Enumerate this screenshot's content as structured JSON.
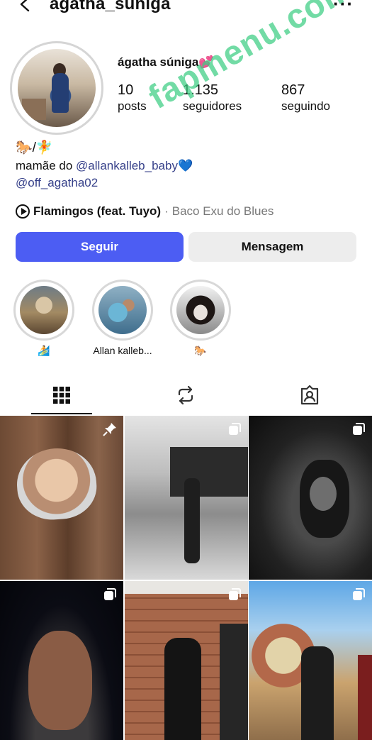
{
  "header": {
    "username": "agatha_suniga",
    "more_glyph": "···"
  },
  "profile": {
    "display_name": "ágatha súniga💕",
    "stats": [
      {
        "value": "10",
        "label": "posts"
      },
      {
        "value": "1.135",
        "label": "seguidores"
      },
      {
        "value": "867",
        "label": "seguindo"
      }
    ],
    "bio_emoji": "🐎/🧚",
    "bio_text": "mamãe do ",
    "bio_mention": "@allankalleb_baby",
    "bio_heart": "💙",
    "bio_link": "@off_agatha02"
  },
  "music": {
    "song": "Flamingos (feat. Tuyo)",
    "separator": "·",
    "artist": "Baco Exu do Blues"
  },
  "actions": {
    "follow_label": "Seguir",
    "message_label": "Mensagem"
  },
  "highlights": [
    {
      "label": "🏄"
    },
    {
      "label": "Allan kalleb..."
    },
    {
      "label": "🐎"
    }
  ],
  "tabs": [
    {
      "icon": "grid-icon"
    },
    {
      "icon": "reels-repost-icon"
    },
    {
      "icon": "tagged-icon"
    }
  ],
  "watermark": "fapmenu.com",
  "colors": {
    "follow_button": "#4c5df3",
    "mention": "#37418a",
    "watermark": "#3ccd82"
  }
}
